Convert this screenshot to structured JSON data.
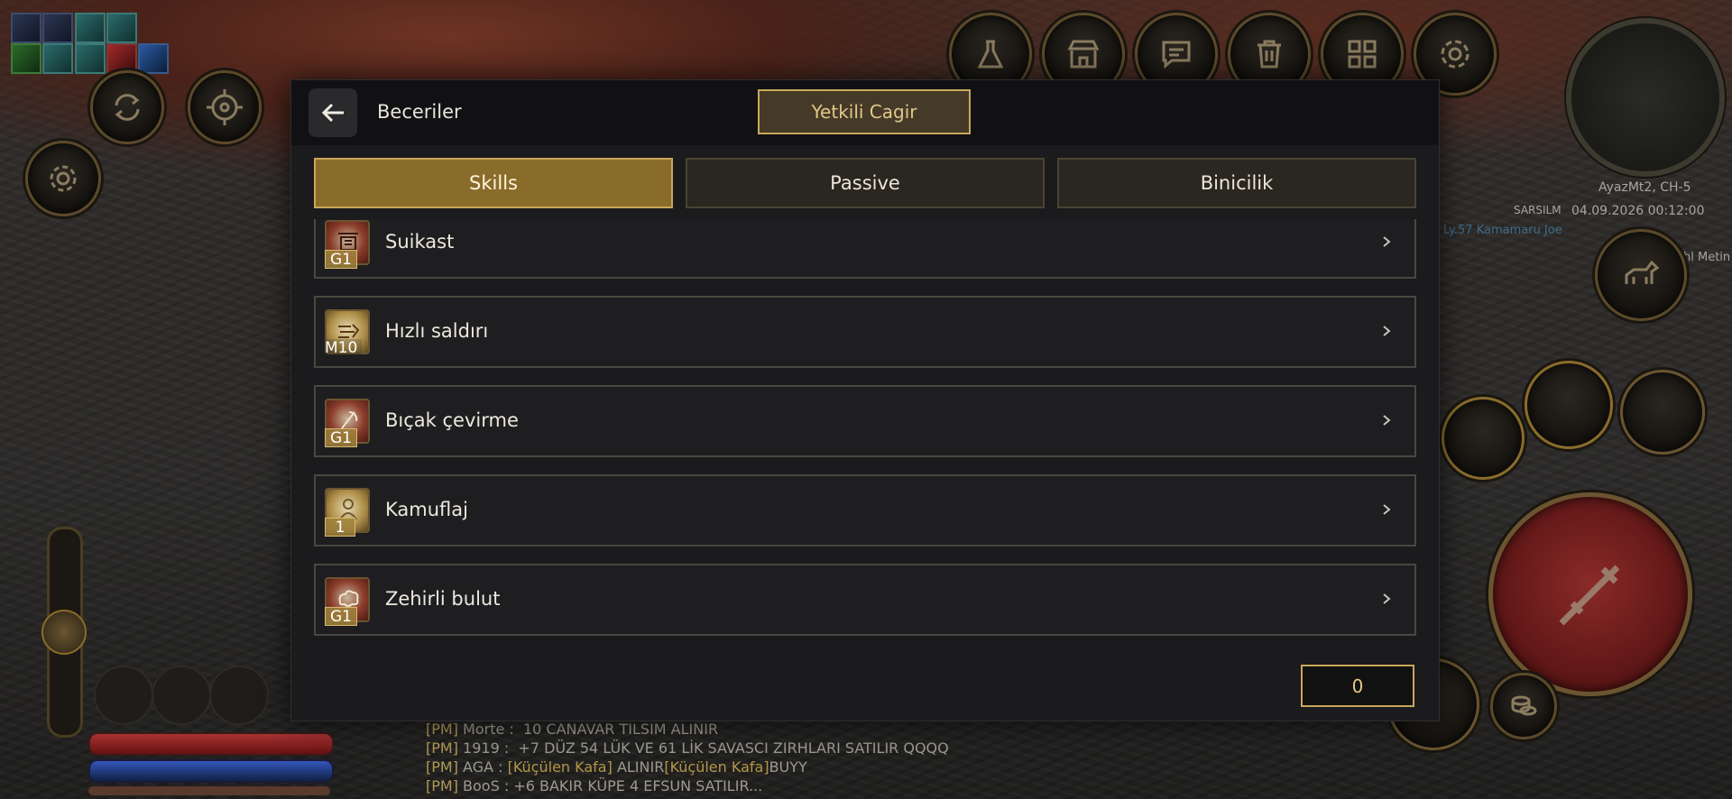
{
  "dialog": {
    "title": "Beceriler",
    "call_button": "Yetkili Cagir",
    "tabs": [
      {
        "label": "Skills",
        "active": true
      },
      {
        "label": "Passive",
        "active": false
      },
      {
        "label": "Binicilik",
        "active": false
      }
    ],
    "skills": [
      {
        "name": "Suikast",
        "level": "G1",
        "icon": "assassination-skill-icon"
      },
      {
        "name": "Hızlı saldırı",
        "level": "M10",
        "icon": "rapid-attack-skill-icon"
      },
      {
        "name": "Bıçak çevirme",
        "level": "G1",
        "icon": "blade-spin-skill-icon"
      },
      {
        "name": "Kamuflaj",
        "level": "1",
        "icon": "camouflage-skill-icon"
      },
      {
        "name": "Zehirli bulut",
        "level": "G1",
        "icon": "poison-cloud-skill-icon"
      }
    ],
    "skill_points": "0"
  },
  "hud": {
    "server": "AyazMt2, CH-5",
    "player_tag": "SARSILM",
    "datetime": "04.09.2026 00:12:00",
    "nearby_player": "Ly.57 Kamamaru Joe",
    "nearby_label": "hl Metin",
    "top_buttons": [
      "flask-icon",
      "shop-icon",
      "chat-icon",
      "trash-icon",
      "grid-icon",
      "gear-icon"
    ]
  },
  "chat": [
    {
      "tag": "[PM]",
      "sender": "Morte",
      "message": "10 CANAVAR TILSIM ALINIR"
    },
    {
      "tag": "[PM]",
      "sender": "1919",
      "message": "+7 DÜZ 54 LÜK VE 61 LİK SAVASCI ZIRHLARI SATILIR QQQQ"
    },
    {
      "tag": "[PM]",
      "sender": "AGA",
      "item1": "[Küçülen Kafa]",
      "middle": "ALINIR",
      "item2": "[Küçülen Kafa]",
      "end": "BUYY"
    },
    {
      "tag": "[PM]",
      "sender": "BooS",
      "message": "+6 BAKIR KÜPE 4 EFSUN SATILIR..."
    }
  ],
  "colors": {
    "accent_gold": "#c9a75a",
    "active_tab": "#8a6c2a",
    "panel_bg": "#1b1b1d"
  }
}
